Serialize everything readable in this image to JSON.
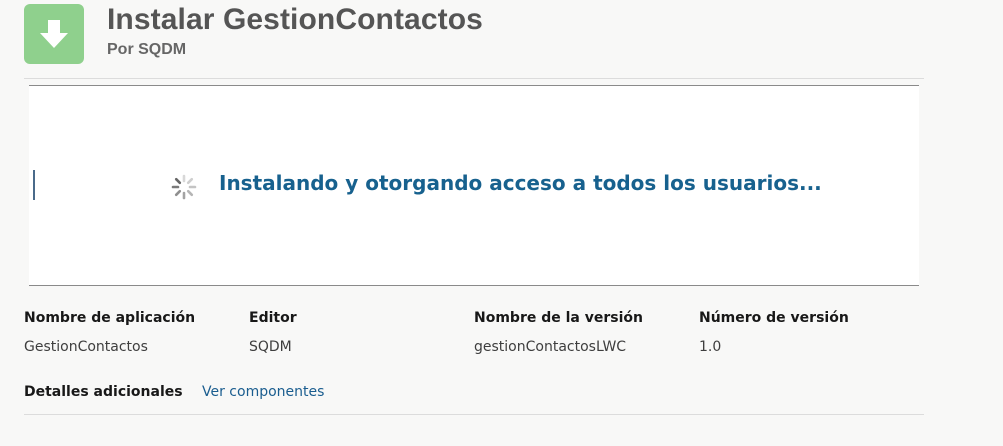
{
  "header": {
    "title": "Instalar GestionContactos",
    "subtitle": "Por SQDM",
    "icon": "download-arrow-icon",
    "icon_color": "#8fd08d"
  },
  "progress": {
    "status": "Instalando y otorgando acceso a todos los usuarios...",
    "status_color": "#17618e",
    "icon": "loading-spinner-icon"
  },
  "details": {
    "columns": [
      {
        "label": "Nombre de aplicación",
        "value": "GestionContactos"
      },
      {
        "label": "Editor",
        "value": "SQDM"
      },
      {
        "label": "Nombre de la versión",
        "value": "gestionContactosLWC"
      },
      {
        "label": "Número de versión",
        "value": "1.0"
      }
    ],
    "additional_label": "Detalles adicionales",
    "view_components_link": "Ver componentes",
    "link_color": "#1a5d8f"
  }
}
